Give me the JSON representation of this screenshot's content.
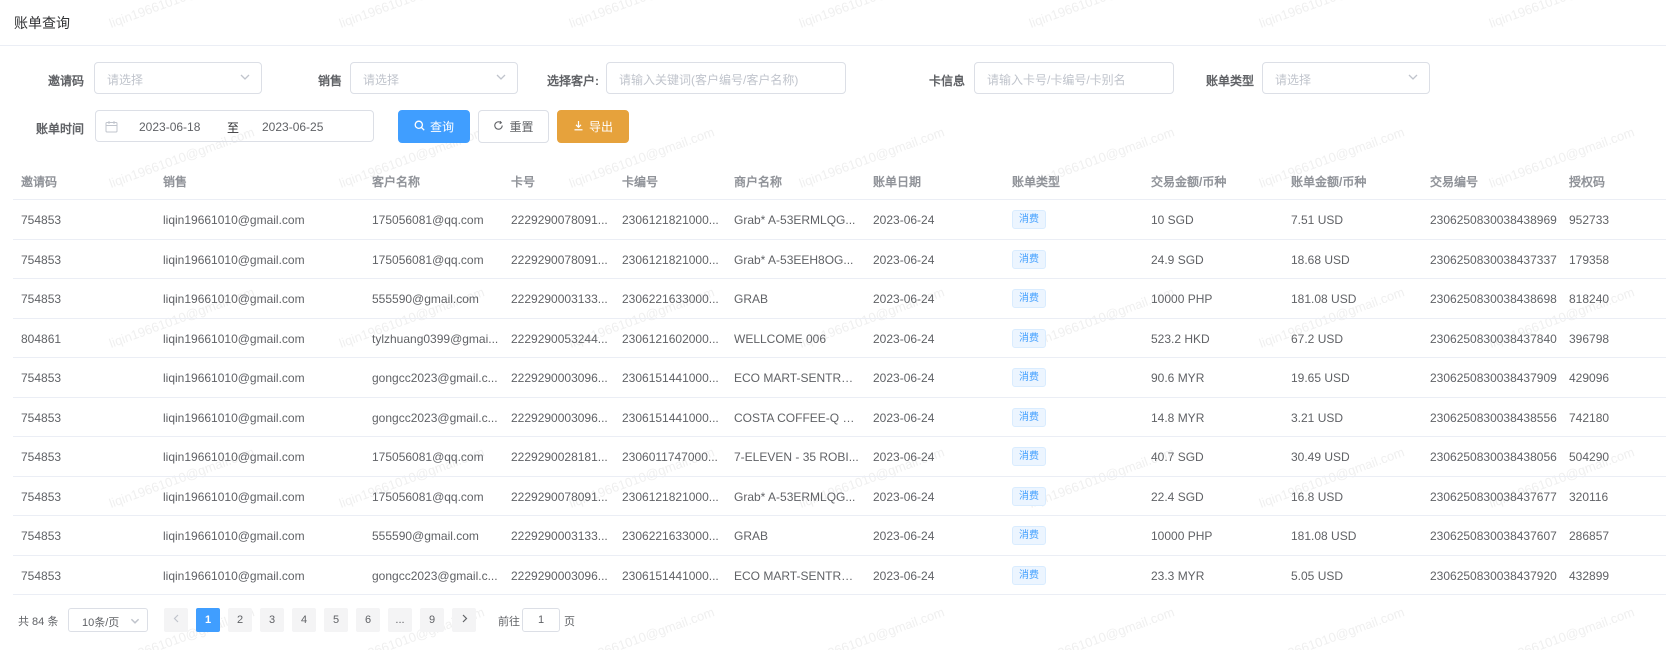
{
  "page": {
    "title": "账单查询",
    "watermark": "liqin19661010@gmail.com"
  },
  "filters": {
    "invite_code": {
      "label": "邀请码",
      "placeholder": "请选择"
    },
    "sales": {
      "label": "销售",
      "placeholder": "请选择"
    },
    "customer": {
      "label": "选择客户:",
      "placeholder": "请输入关键词(客户编号/客户名称)"
    },
    "card_info": {
      "label": "卡信息",
      "placeholder": "请输入卡号/卡编号/卡别名"
    },
    "bill_type": {
      "label": "账单类型",
      "placeholder": "请选择"
    },
    "bill_time": {
      "label": "账单时间",
      "start": "2023-06-18",
      "separator": "至",
      "end": "2023-06-25"
    }
  },
  "buttons": {
    "query": "查询",
    "reset": "重置",
    "export": "导出"
  },
  "table": {
    "columns": [
      "邀请码",
      "销售",
      "客户名称",
      "卡号",
      "卡编号",
      "商户名称",
      "账单日期",
      "账单类型",
      "交易金额/币种",
      "账单金额/币种",
      "交易编号",
      "授权码"
    ],
    "rows": [
      {
        "invite": "754853",
        "sales": "liqin19661010@gmail.com",
        "customer": "175056081@qq.com",
        "card_no": "2229290078091...",
        "card_id": "2306121821000...",
        "merchant": "Grab* A-53ERMLQG...",
        "date": "2023-06-24",
        "type": "消费",
        "txn_amount": "10 SGD",
        "bill_amount": "7.51 USD",
        "txn_no": "2306250830038438969",
        "auth": "952733"
      },
      {
        "invite": "754853",
        "sales": "liqin19661010@gmail.com",
        "customer": "175056081@qq.com",
        "card_no": "2229290078091...",
        "card_id": "2306121821000...",
        "merchant": "Grab* A-53EEH8OG...",
        "date": "2023-06-24",
        "type": "消费",
        "txn_amount": "24.9 SGD",
        "bill_amount": "18.68 USD",
        "txn_no": "2306250830038437337",
        "auth": "179358"
      },
      {
        "invite": "754853",
        "sales": "liqin19661010@gmail.com",
        "customer": "555590@gmail.com",
        "card_no": "2229290003133...",
        "card_id": "2306221633000...",
        "merchant": "GRAB",
        "date": "2023-06-24",
        "type": "消费",
        "txn_amount": "10000 PHP",
        "bill_amount": "181.08 USD",
        "txn_no": "2306250830038438698",
        "auth": "818240"
      },
      {
        "invite": "804861",
        "sales": "liqin19661010@gmail.com",
        "customer": "tylzhuang0399@gmai...",
        "card_no": "2229290053244...",
        "card_id": "2306121602000...",
        "merchant": "WELLCOME 006",
        "date": "2023-06-24",
        "type": "消费",
        "txn_amount": "523.2 HKD",
        "bill_amount": "67.2 USD",
        "txn_no": "2306250830038437840",
        "auth": "396798"
      },
      {
        "invite": "754853",
        "sales": "liqin19661010@gmail.com",
        "customer": "gongcc2023@gmail.c...",
        "card_no": "2229290003096...",
        "card_id": "2306151441000...",
        "merchant": "ECO MART-SENTRA...",
        "date": "2023-06-24",
        "type": "消费",
        "txn_amount": "90.6 MYR",
        "bill_amount": "19.65 USD",
        "txn_no": "2306250830038437909",
        "auth": "429096"
      },
      {
        "invite": "754853",
        "sales": "liqin19661010@gmail.com",
        "customer": "gongcc2023@gmail.c...",
        "card_no": "2229290003096...",
        "card_id": "2306151441000...",
        "merchant": "COSTA COFFEE-Q S...",
        "date": "2023-06-24",
        "type": "消费",
        "txn_amount": "14.8 MYR",
        "bill_amount": "3.21 USD",
        "txn_no": "2306250830038438556",
        "auth": "742180"
      },
      {
        "invite": "754853",
        "sales": "liqin19661010@gmail.com",
        "customer": "175056081@qq.com",
        "card_no": "2229290028181...",
        "card_id": "2306011747000...",
        "merchant": "7-ELEVEN - 35 ROBI...",
        "date": "2023-06-24",
        "type": "消费",
        "txn_amount": "40.7 SGD",
        "bill_amount": "30.49 USD",
        "txn_no": "2306250830038438056",
        "auth": "504290"
      },
      {
        "invite": "754853",
        "sales": "liqin19661010@gmail.com",
        "customer": "175056081@qq.com",
        "card_no": "2229290078091...",
        "card_id": "2306121821000...",
        "merchant": "Grab* A-53ERMLQG...",
        "date": "2023-06-24",
        "type": "消费",
        "txn_amount": "22.4 SGD",
        "bill_amount": "16.8 USD",
        "txn_no": "2306250830038437677",
        "auth": "320116"
      },
      {
        "invite": "754853",
        "sales": "liqin19661010@gmail.com",
        "customer": "555590@gmail.com",
        "card_no": "2229290003133...",
        "card_id": "2306221633000...",
        "merchant": "GRAB",
        "date": "2023-06-24",
        "type": "消费",
        "txn_amount": "10000 PHP",
        "bill_amount": "181.08 USD",
        "txn_no": "2306250830038437607",
        "auth": "286857"
      },
      {
        "invite": "754853",
        "sales": "liqin19661010@gmail.com",
        "customer": "gongcc2023@gmail.c...",
        "card_no": "2229290003096...",
        "card_id": "2306151441000...",
        "merchant": "ECO MART-SENTRA...",
        "date": "2023-06-24",
        "type": "消费",
        "txn_amount": "23.3 MYR",
        "bill_amount": "5.05 USD",
        "txn_no": "2306250830038437920",
        "auth": "432899"
      }
    ]
  },
  "pagination": {
    "total": "共 84 条",
    "page_size": "10条/页",
    "pages": [
      "1",
      "2",
      "3",
      "4",
      "5",
      "6",
      "...",
      "9"
    ],
    "current": "1",
    "goto_label": "前往",
    "goto_value": "1",
    "goto_suffix": "页"
  },
  "colors": {
    "primary": "#409eff",
    "warning": "#e6a23c",
    "border": "#ebeef5"
  }
}
